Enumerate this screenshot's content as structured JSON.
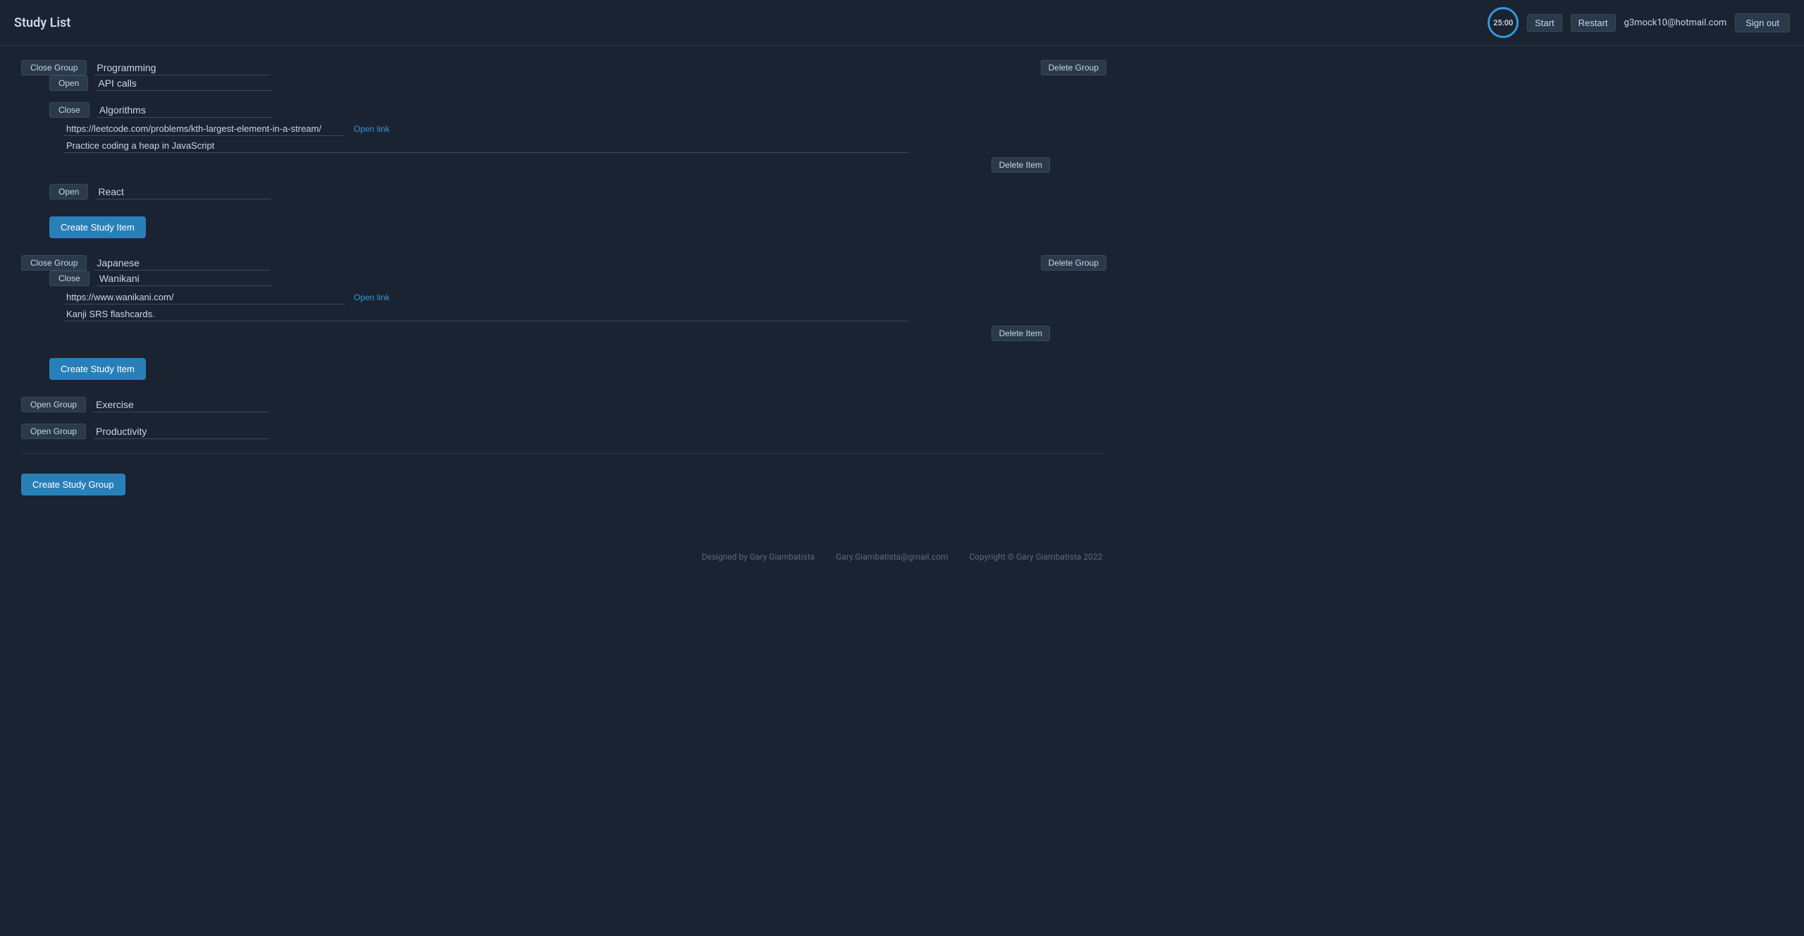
{
  "header": {
    "title": "Study List",
    "timer": "25:00",
    "start_label": "Start",
    "restart_label": "Restart",
    "user_email": "g3mock10@hotmail.com",
    "signout_label": "Sign out"
  },
  "groups": [
    {
      "id": "programming",
      "toggle_label": "Close Group",
      "name": "Programming",
      "is_open": true,
      "delete_label": "Delete Group",
      "items": [
        {
          "id": "api-calls",
          "toggle_label": "Open",
          "name": "API calls",
          "is_open": false,
          "link": "",
          "notes": "",
          "open_link_label": "",
          "delete_label": ""
        },
        {
          "id": "algorithms",
          "toggle_label": "Close",
          "name": "Algorithms",
          "is_open": true,
          "link": "https://leetcode.com/problems/kth-largest-element-in-a-stream/",
          "open_link_label": "Open link",
          "notes": "Practice coding a heap in JavaScript",
          "delete_label": "Delete Item"
        },
        {
          "id": "react",
          "toggle_label": "Open",
          "name": "React",
          "is_open": false,
          "link": "",
          "notes": "",
          "open_link_label": "",
          "delete_label": ""
        }
      ],
      "create_item_label": "Create Study Item"
    },
    {
      "id": "japanese",
      "toggle_label": "Close Group",
      "name": "Japanese",
      "is_open": true,
      "delete_label": "Delete Group",
      "items": [
        {
          "id": "wanikani",
          "toggle_label": "Close",
          "name": "Wanikani",
          "is_open": true,
          "link": "https://www.wanikani.com/",
          "open_link_label": "Open link",
          "notes": "Kanji SRS flashcards.",
          "delete_label": "Delete Item"
        }
      ],
      "create_item_label": "Create Study Item"
    },
    {
      "id": "exercise",
      "toggle_label": "Open Group",
      "name": "Exercise",
      "is_open": false,
      "delete_label": "",
      "items": [],
      "create_item_label": ""
    },
    {
      "id": "productivity",
      "toggle_label": "Open Group",
      "name": "Productivity",
      "is_open": false,
      "delete_label": "",
      "items": [],
      "create_item_label": ""
    }
  ],
  "create_group_label": "Create Study Group",
  "footer": {
    "designed_by": "Designed by Gary Giambatista",
    "email": "Gary.Giambatista@gmail.com",
    "copyright": "Copyright © Gary Giambatista 2022"
  }
}
